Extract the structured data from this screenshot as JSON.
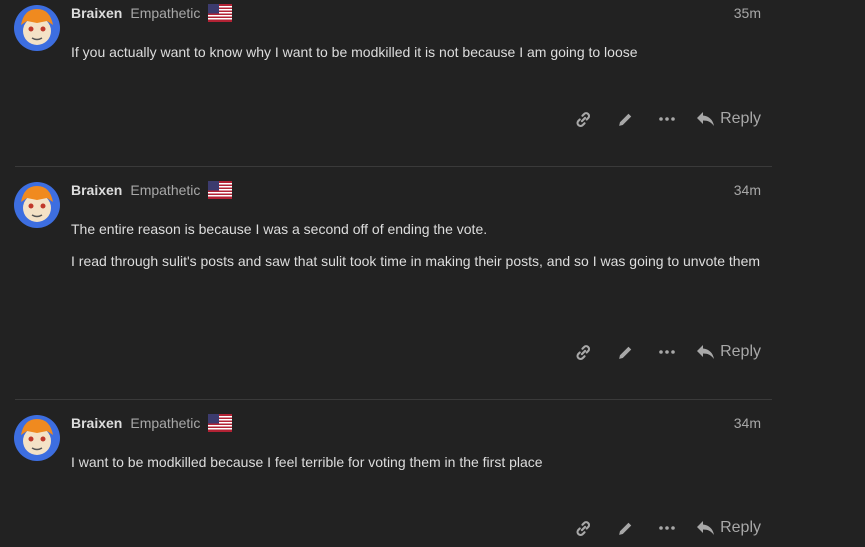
{
  "posts": [
    {
      "username": "Braixen",
      "user_title": "Empathetic",
      "time": "35m",
      "paragraphs": [
        "If you actually want to know why I want to be modkilled it is not because I am going to loose"
      ],
      "reply_label": "Reply"
    },
    {
      "username": "Braixen",
      "user_title": "Empathetic",
      "time": "34m",
      "paragraphs": [
        "The entire reason is because I was a second off of ending the vote.",
        "I read through sulit's posts and saw that sulit took time in making their posts, and so I was going to unvote them"
      ],
      "reply_label": "Reply"
    },
    {
      "username": "Braixen",
      "user_title": "Empathetic",
      "time": "34m",
      "paragraphs": [
        "I want to be modkilled because I feel terrible for voting them in the first place"
      ],
      "reply_label": "Reply"
    }
  ],
  "colors": {
    "background": "#222222",
    "text": "#dddddd",
    "muted": "#a8a8a8",
    "divider": "#3a3a3a"
  },
  "icons": [
    "link-icon",
    "pencil-icon",
    "more-icon",
    "reply-icon",
    "us-flag-icon"
  ]
}
